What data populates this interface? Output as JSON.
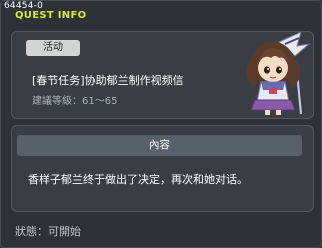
{
  "window": {
    "quest_id": "64454-0",
    "title": "QUEST INFO"
  },
  "quest": {
    "badge": "活动",
    "name": "[春节任务]协助郁兰制作视频信",
    "level_req": "建議等級：61～65",
    "portrait_icon": "npc-girl-portrait"
  },
  "content": {
    "header": "內容",
    "text": "香样子郁兰终于做出了决定，再次和她对话。"
  },
  "status": {
    "text": "狀態：可開始"
  },
  "colors": {
    "title_accent": "#d8ec2a",
    "panel_bg": "#3a3e44",
    "header_bar": "#58606a"
  }
}
